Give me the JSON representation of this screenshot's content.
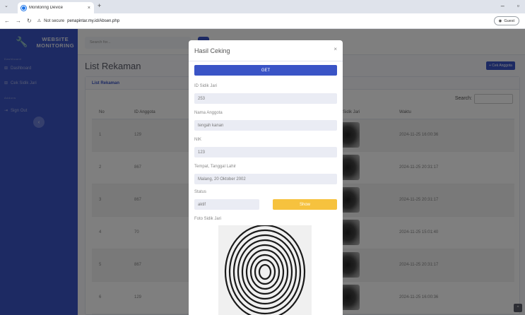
{
  "browser": {
    "tab_title": "Monitoring Device",
    "url_secure": "Not secure",
    "url": "penapintar.my.id/Absen.php",
    "profile": "Guest"
  },
  "sidebar": {
    "brand_line1": "WEBSITE",
    "brand_line2": "MONITORING",
    "heading_main": "Dashboard",
    "items": [
      {
        "label": "Dashboard"
      },
      {
        "label": "Cek Sidik Jari"
      },
      {
        "label": "Sign Out"
      }
    ],
    "heading_addons": "Addons"
  },
  "topbar": {
    "search_placeholder": "Search for..."
  },
  "page": {
    "title": "List Rekaman",
    "add_button": "+ Cek Anggota",
    "card_title": "List Rekaman",
    "search_label": "Search:",
    "table": {
      "headers": [
        "No",
        "ID Anggota",
        "Sidik Jari",
        "Waktu"
      ],
      "rows": [
        {
          "no": "1",
          "id": "129",
          "waktu": "2024-11-25 16:00:36"
        },
        {
          "no": "2",
          "id": "867",
          "waktu": "2024-11-25 20:31:17"
        },
        {
          "no": "3",
          "id": "867",
          "waktu": "2024-11-25 20:31:17"
        },
        {
          "no": "4",
          "id": "70",
          "waktu": "2024-11-25 15:01:40"
        },
        {
          "no": "5",
          "id": "867",
          "waktu": "2024-11-25 20:31:17"
        },
        {
          "no": "6",
          "id": "129",
          "waktu": "2024-11-25 16:00:36"
        }
      ]
    }
  },
  "modal": {
    "title": "Hasil Ceking",
    "close": "×",
    "get_button": "GET",
    "fields": {
      "id_label": "ID Sidik Jari",
      "id_value": "253",
      "nama_label": "Nama Anggota",
      "nama_value": "tengah kanan",
      "nik_label": "NIK",
      "nik_value": "123",
      "ttl_label": "Tempat, Tanggal Lahir",
      "ttl_value": "Malang, 20 Oktober 2002",
      "status_label": "Status",
      "status_value": "aktif",
      "show_button": "Show",
      "foto_label": "Foto Sidik Jari"
    }
  },
  "colors": {
    "primary": "#3a54c6",
    "warning": "#f6c23e"
  }
}
